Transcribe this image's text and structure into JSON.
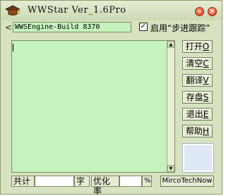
{
  "window": {
    "title": "WWStar Ver_1.6Pro"
  },
  "toolbar": {
    "build_value": "WWSEngine-Build 8370",
    "checkbox_checked": true,
    "checkbox_label": "启用“步进跟踪”"
  },
  "side_buttons": [
    {
      "text": "打开",
      "key": "O"
    },
    {
      "text": "清空",
      "key": "C"
    },
    {
      "text": "翻译",
      "key": "V"
    },
    {
      "text": "存盘",
      "key": "S"
    },
    {
      "text": "退出",
      "key": "E"
    },
    {
      "text": "帮助",
      "key": "H"
    }
  ],
  "status": {
    "total_label": "共计",
    "total_value": "",
    "unit_label": "字",
    "optimize_label": "优化率",
    "optimize_value": "",
    "percent_label": "%",
    "brand_button": "MircoTechNow"
  },
  "icons": {
    "app": "mortarboard-icon",
    "minimize": "minimize-icon",
    "close": "close-icon",
    "back": "back-arrow-icon"
  },
  "colors": {
    "window_bg": "#d7e3c0",
    "editor_bg": "#c6f2c0",
    "close_button": "#d23a1a"
  }
}
